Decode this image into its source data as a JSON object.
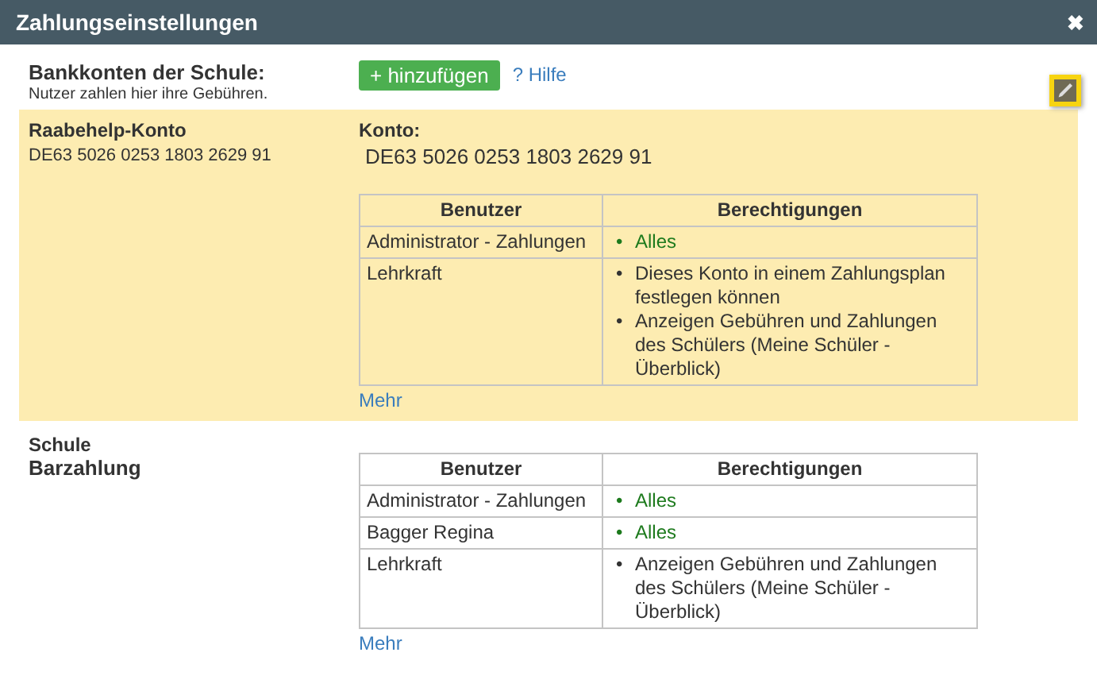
{
  "window": {
    "title": "Zahlungseinstellungen",
    "close": "✖"
  },
  "header": {
    "title": "Bankkonten der Schule:",
    "subtitle": "Nutzer zahlen hier ihre Gebühren.",
    "add_button": "+ hinzufügen",
    "help_link": "? Hilfe"
  },
  "accounts": [
    {
      "name": "Raabehelp-Konto",
      "detail": "DE63 5026 0253 1803 2629 91",
      "selected": true,
      "konto_label": "Konto:",
      "konto_value": "DE63 5026 0253 1803 2629 91",
      "more": "Mehr",
      "columns": [
        "Benutzer",
        "Berechtigungen"
      ],
      "rows": [
        {
          "user": "Administrator - Zahlungen",
          "permissions": [
            {
              "bullet": "•",
              "text": "Alles",
              "kind": "full"
            }
          ]
        },
        {
          "user": "Lehrkraft",
          "permissions": [
            {
              "bullet": "•",
              "text": "Dieses Konto in einem Zahlungsplan festlegen können",
              "kind": "limited"
            },
            {
              "bullet": "•",
              "text": "Anzeigen Gebühren und Zahlungen des Schülers (Meine Schüler - Überblick)",
              "kind": "limited"
            }
          ]
        }
      ]
    },
    {
      "name": "Schule",
      "detail": "Barzahlung",
      "selected": false,
      "more": "Mehr",
      "columns": [
        "Benutzer",
        "Berechtigungen"
      ],
      "rows": [
        {
          "user": "Administrator - Zahlungen",
          "permissions": [
            {
              "bullet": "•",
              "text": "Alles",
              "kind": "full"
            }
          ]
        },
        {
          "user": "Bagger Regina",
          "permissions": [
            {
              "bullet": "•",
              "text": "Alles",
              "kind": "full"
            }
          ]
        },
        {
          "user": "Lehrkraft",
          "permissions": [
            {
              "bullet": "•",
              "text": "Anzeigen Gebühren und Zahlungen des Schülers (Meine Schüler - Überblick)",
              "kind": "limited"
            }
          ]
        }
      ]
    }
  ]
}
